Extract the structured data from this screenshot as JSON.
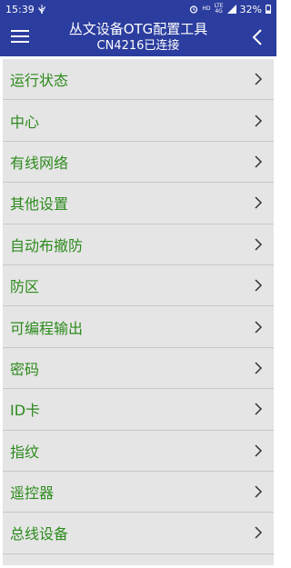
{
  "status": {
    "time": "15:39",
    "hd": "HD",
    "lte_top": "LTE",
    "lte_bottom": "4G",
    "battery": "32%"
  },
  "header": {
    "title": "丛文设备OTG配置工具",
    "subtitle": "CN4216已连接",
    "menu_icon": "hamburger-menu-icon",
    "back_icon": "chevron-left-icon"
  },
  "menu": {
    "items": [
      {
        "label": "运行状态"
      },
      {
        "label": "中心"
      },
      {
        "label": "有线网络"
      },
      {
        "label": "其他设置"
      },
      {
        "label": "自动布撤防"
      },
      {
        "label": "防区"
      },
      {
        "label": "可编程输出"
      },
      {
        "label": "密码"
      },
      {
        "label": "ID卡"
      },
      {
        "label": "指纹"
      },
      {
        "label": "遥控器"
      },
      {
        "label": "总线设备"
      }
    ]
  },
  "colors": {
    "primary": "#2b3d9e",
    "item_text": "#2c8a1c",
    "list_bg": "#e5e5e5",
    "divider": "#c8c8c8"
  }
}
